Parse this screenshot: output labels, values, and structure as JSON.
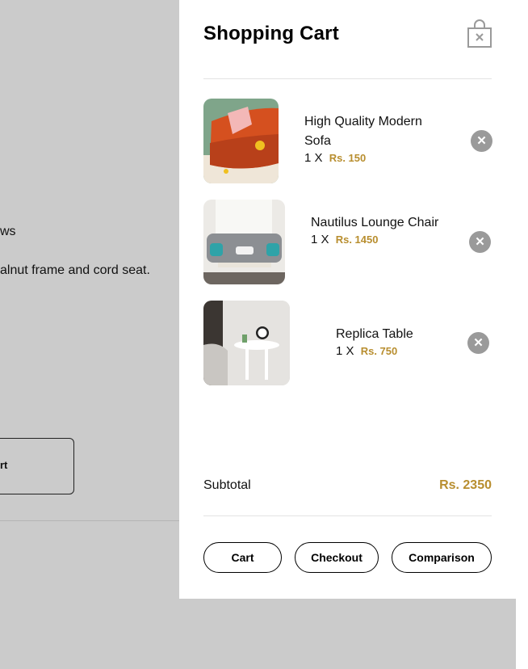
{
  "background_page": {
    "text_line_1": "ws",
    "text_line_2": "alnut frame and cord seat.",
    "button_label": "rt"
  },
  "cart": {
    "title": "Shopping Cart",
    "items": [
      {
        "name": "High Quality Modern Sofa",
        "qty": "1",
        "times": "X",
        "price": "Rs. 150",
        "image_icon": "sofa-image",
        "remove_icon": "remove-item-icon"
      },
      {
        "name": "Nautilus Lounge Chair",
        "qty": "1",
        "times": "X",
        "price": "Rs. 1450",
        "image_icon": "lounge-chair-image",
        "remove_icon": "remove-item-icon"
      },
      {
        "name": "Replica Table",
        "qty": "1",
        "times": "X",
        "price": "Rs. 750",
        "image_icon": "table-image",
        "remove_icon": "remove-item-icon"
      }
    ],
    "subtotal_label": "Subtotal",
    "subtotal_value": "Rs. 2350",
    "buttons": {
      "cart": "Cart",
      "checkout": "Checkout",
      "comparison": "Comparison"
    }
  },
  "colors": {
    "accent": "#B88E2F",
    "overlay": "#cbcbcb",
    "remove_bg": "#9a9a9a"
  }
}
